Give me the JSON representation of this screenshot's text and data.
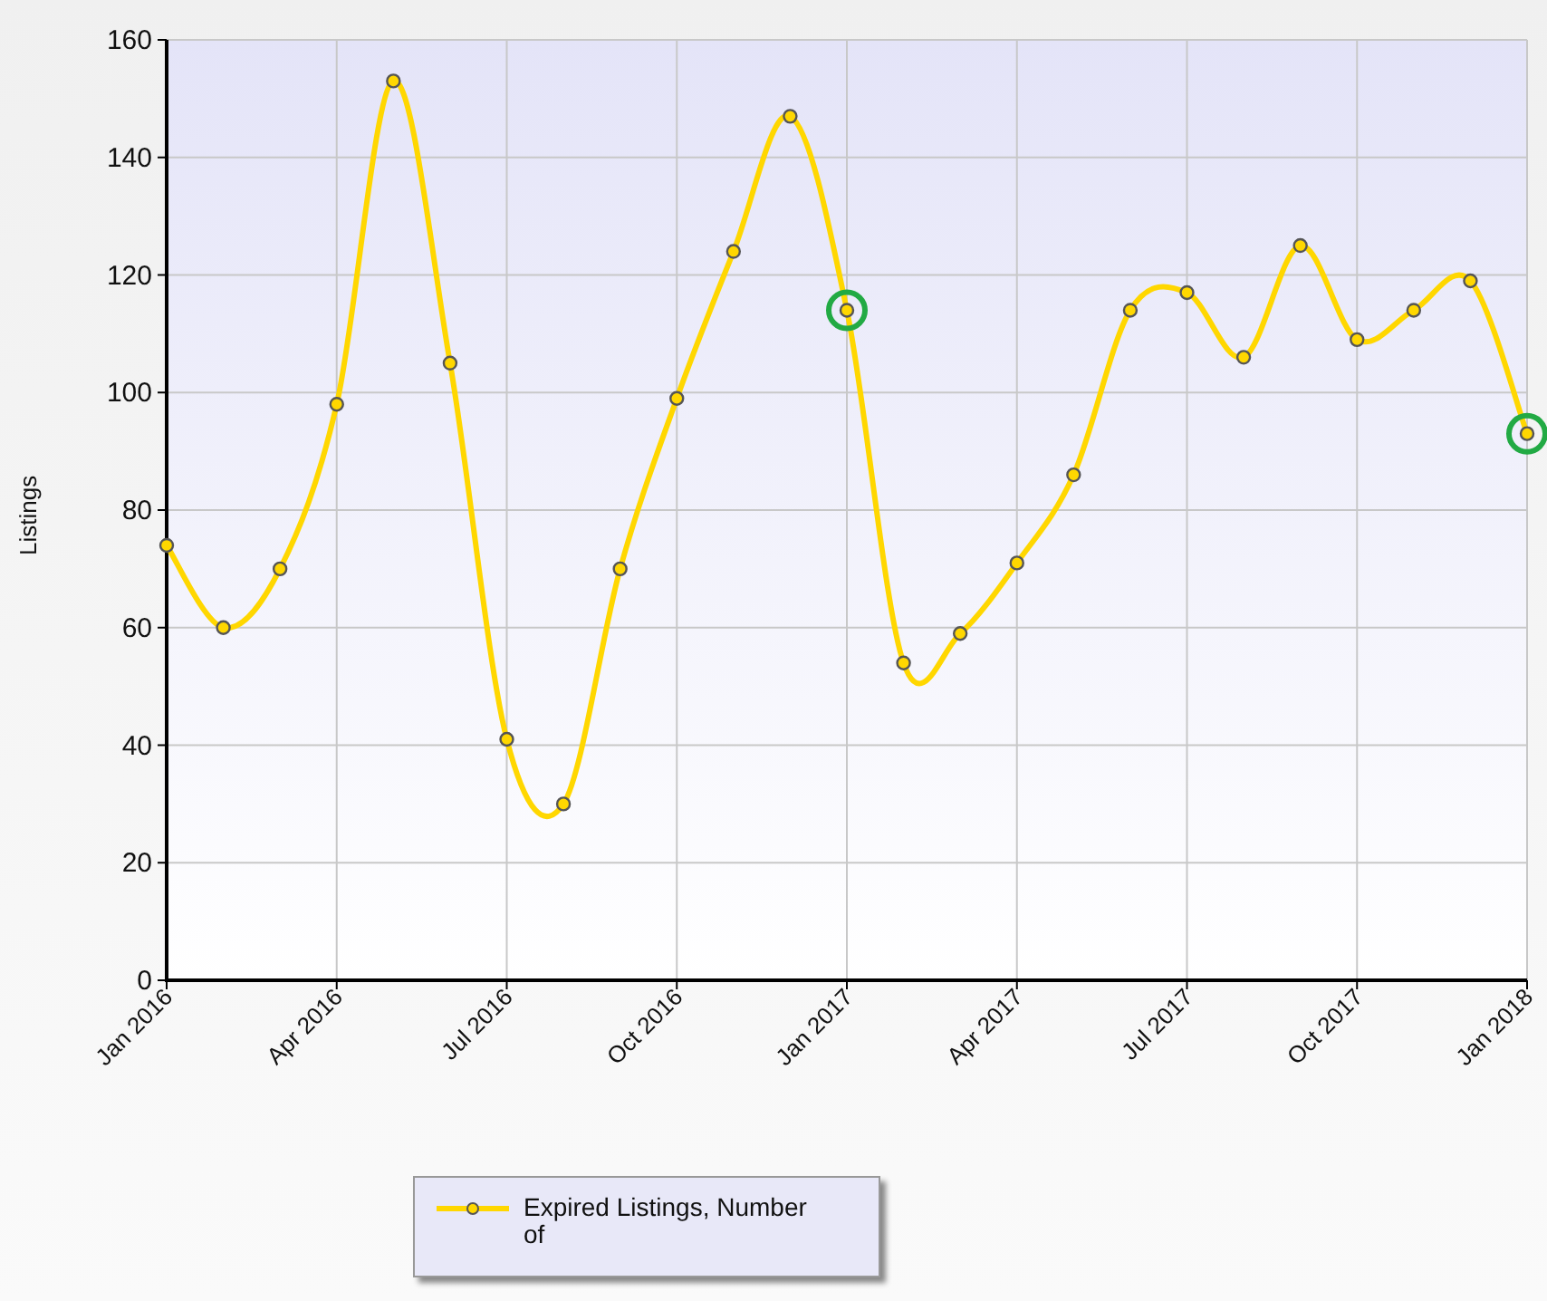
{
  "chart": {
    "chart_data": {
      "type": "line",
      "ylabel": "Listings",
      "categories": [
        "Jan 2016",
        null,
        null,
        "Apr 2016",
        null,
        null,
        "Jul 2016",
        null,
        null,
        "Oct 2016",
        null,
        null,
        "Jan 2017",
        null,
        null,
        "Apr 2017",
        null,
        null,
        "Jul 2017",
        null,
        null,
        "Oct 2017",
        null,
        null,
        "Jan 2018"
      ],
      "series": [
        {
          "name": "Expired Listings, Number of",
          "color": "#ffd700",
          "marker": "circle",
          "values": [
            74,
            60,
            70,
            98,
            153,
            105,
            41,
            30,
            70,
            99,
            124,
            147,
            114,
            54,
            59,
            71,
            86,
            114,
            117,
            106,
            125,
            109,
            114,
            119,
            93
          ]
        }
      ],
      "ylim": [
        0,
        160
      ],
      "grid": true,
      "yticks": [
        0,
        20,
        40,
        60,
        80,
        100,
        120,
        140,
        160
      ],
      "annotations": [
        {
          "x": "Jan 2017"
        },
        {
          "x": "Jan 2018"
        }
      ]
    }
  }
}
